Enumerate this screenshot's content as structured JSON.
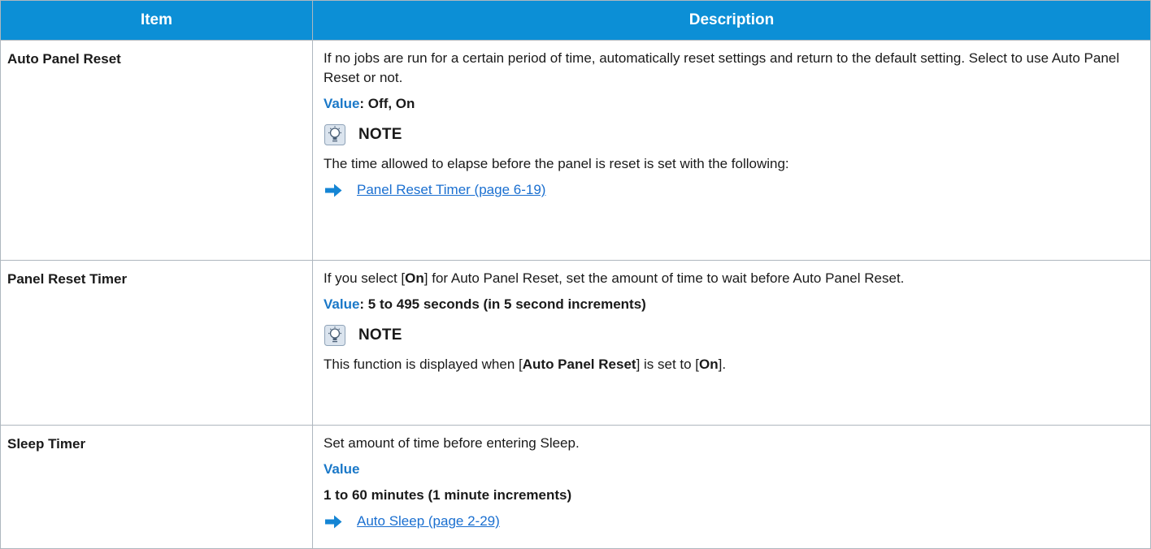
{
  "table": {
    "headers": {
      "item": "Item",
      "description": "Description"
    },
    "rows": [
      {
        "item": "Auto Panel Reset",
        "paragraph": "If no jobs are run for a certain period of time, automatically reset settings and return to the default setting. Select to use Auto Panel Reset or not.",
        "value_label": "Value",
        "value_text": ": Off, On",
        "note_title": "NOTE",
        "note_text": "The time allowed to elapse before the panel is reset is set with the following:",
        "ref_link": "Panel Reset Timer (page 6-19)"
      },
      {
        "item": "Panel Reset Timer",
        "paragraph": "If you select [On] for Auto Panel Reset, set the amount of time to wait before Auto Panel Reset.",
        "paragraph_parts": [
          "If you select [",
          "On",
          "] for Auto Panel Reset, set the amount of time to wait before Auto Panel Reset."
        ],
        "value_label": "Value",
        "value_text": ": 5 to 495 seconds (in 5 second increments)",
        "note_title": "NOTE",
        "note_parts": [
          "This function is displayed when [",
          "Auto Panel Reset",
          "] is set to [",
          "On",
          "]."
        ]
      },
      {
        "item": "Sleep Timer",
        "paragraph": "Set amount of time before entering Sleep.",
        "value_label": "Value",
        "value_text": "1 to 60 minutes (1 minute increments)",
        "ref_link": "Auto Sleep (page 2-29)"
      }
    ]
  },
  "icons": {
    "note": "lightbulb-note-icon",
    "reference": "right-arrow-icon"
  },
  "colors": {
    "header_bg": "#0c8fd6",
    "header_text": "#ffffff",
    "value_label": "#1a78c8",
    "link": "#1a6fd0",
    "arrow": "#1585d4",
    "border": "#aeb7bf"
  }
}
